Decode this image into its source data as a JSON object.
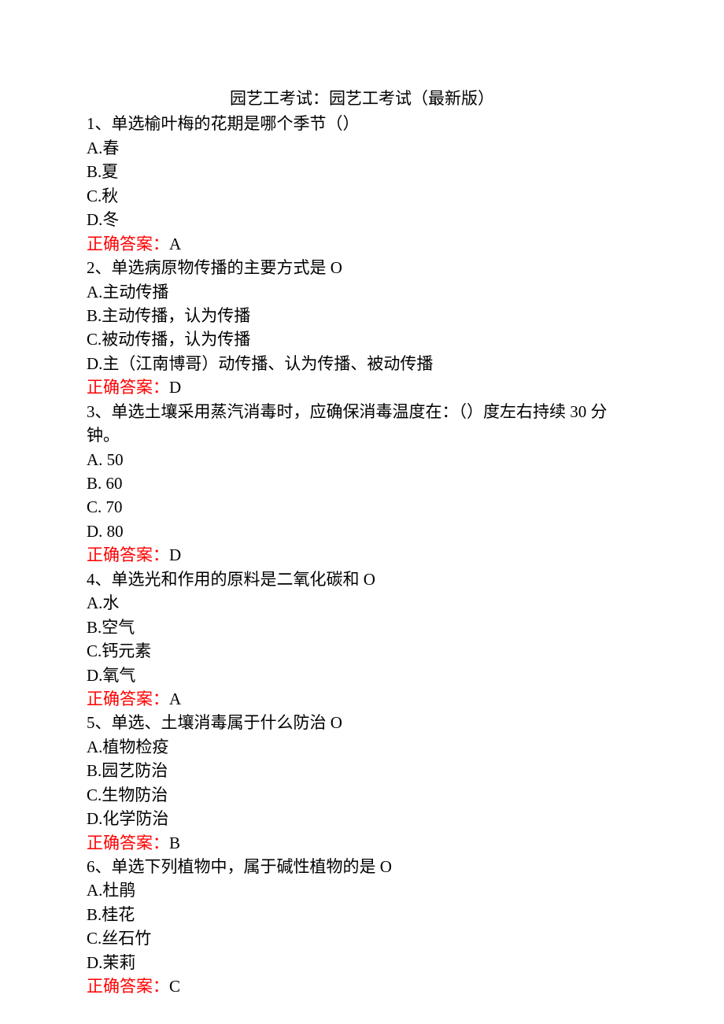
{
  "title": "园艺工考试：园艺工考试（最新版）",
  "answer_label": "正确答案：",
  "questions": [
    {
      "stem": "1、单选榆叶梅的花期是哪个季节（）",
      "options": [
        "A.春",
        "B.夏",
        "C.秋",
        "D.冬"
      ],
      "answer": "A"
    },
    {
      "stem": "2、单选病原物传播的主要方式是 O",
      "options": [
        "A.主动传播",
        "B.主动传播，认为传播",
        "C.被动传播，认为传播",
        "D.主（江南博哥）动传播、认为传播、被动传播"
      ],
      "answer": "D"
    },
    {
      "stem": "3、单选土壤采用蒸汽消毒时，应确保消毒温度在：（）度左右持续 30 分钟。",
      "options": [
        "A. 50",
        "B. 60",
        "C. 70",
        "D. 80"
      ],
      "answer": "D"
    },
    {
      "stem": "4、单选光和作用的原料是二氧化碳和 O",
      "options": [
        "A.水",
        "B.空气",
        "C.钙元素",
        "D.氧气"
      ],
      "answer": "A"
    },
    {
      "stem": "5、单选、土壤消毒属于什么防治 O",
      "options": [
        "A.植物检疫",
        "B.园艺防治",
        "C.生物防治",
        "D.化学防治"
      ],
      "answer": "B"
    },
    {
      "stem": "6、单选下列植物中，属于碱性植物的是 O",
      "options": [
        "A.杜鹃",
        "B.桂花",
        "C.丝石竹",
        "D.茉莉"
      ],
      "answer": "C"
    }
  ]
}
